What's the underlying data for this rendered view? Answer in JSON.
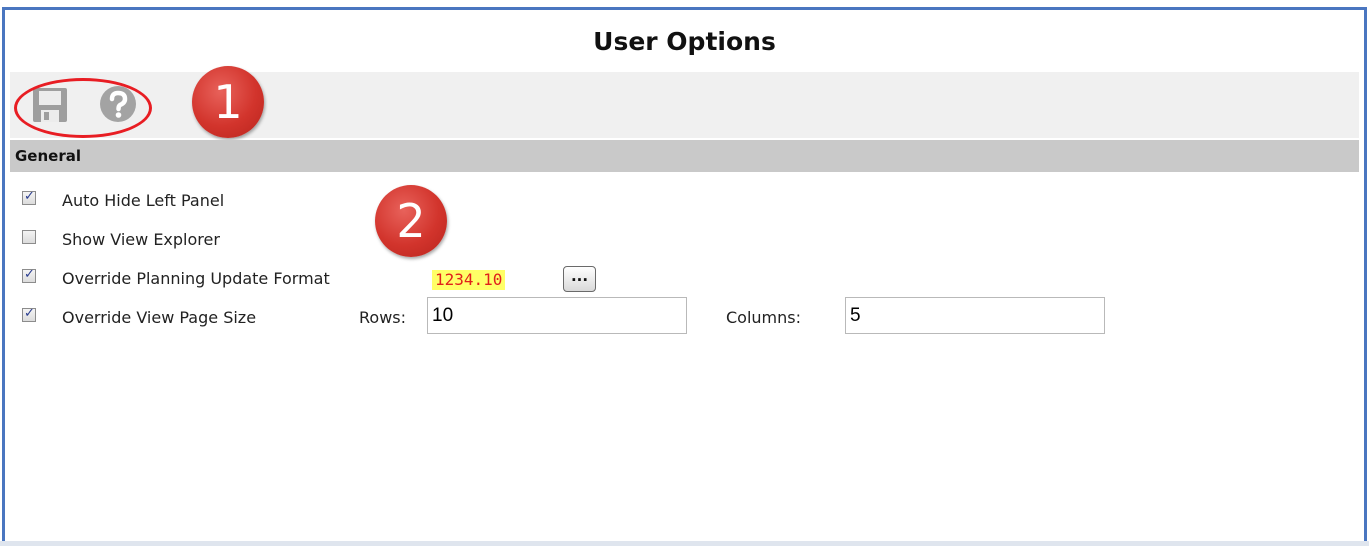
{
  "window": {
    "title": "User Options"
  },
  "toolbar": {
    "save_icon": "save-disk-icon",
    "help_icon": "help-question-icon"
  },
  "callouts": {
    "one": "1",
    "two": "2"
  },
  "section": {
    "title": "General"
  },
  "options": [
    {
      "label": "Auto Hide Left Panel",
      "checked": true
    },
    {
      "label": "Show View Explorer",
      "checked": false
    },
    {
      "label": "Override Planning Update Format",
      "checked": true
    },
    {
      "label": "Override View Page Size",
      "checked": true
    }
  ],
  "format": {
    "sample": "1234.10",
    "button_label": "..."
  },
  "page_size": {
    "rows_label": "Rows:",
    "rows_value": "10",
    "columns_label": "Columns:",
    "columns_value": "5"
  },
  "colors": {
    "frame_border": "#4a76c0",
    "toolbar_bg": "#f0f0f0",
    "section_bg": "#c9c9c9",
    "callout_red": "#d2342c",
    "highlight_yellow": "#ffff66",
    "sample_text_red": "#e0201b"
  }
}
